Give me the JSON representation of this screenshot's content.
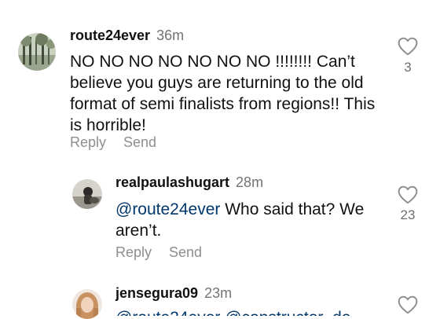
{
  "comments": [
    {
      "username": "route24ever",
      "time": "36m",
      "text": "NO NO NO NO NO NO NO !!!!!!!! Can’t believe you guys are returning to the old format of semi finalists from regions!! This is horrible!",
      "like_count": "3",
      "reply_label": "Reply",
      "send_label": "Send"
    },
    {
      "username": "realpaulashugart",
      "time": "28m",
      "mention": "@route24ever",
      "text": " Who said that?  We aren’t.",
      "like_count": "23",
      "reply_label": "Reply",
      "send_label": "Send"
    },
    {
      "username": "jensegura09",
      "time": "23m",
      "text": "@route24ever @constructor_de"
    }
  ],
  "icons": {
    "like": "heart-outline-icon"
  },
  "colors": {
    "mention": "#00376b",
    "secondary_text": "#737373"
  }
}
